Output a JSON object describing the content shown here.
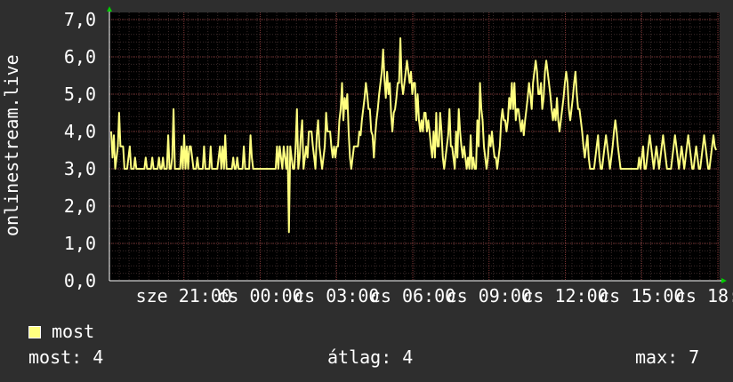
{
  "chart_data": {
    "type": "line",
    "y_axis_label": "onlinestream.live",
    "ylim": [
      0,
      7
    ],
    "y_ticks": [
      "0,0",
      "1,0",
      "2,0",
      "3,0",
      "4,0",
      "5,0",
      "6,0",
      "7,0"
    ],
    "x_ticks": [
      "sze 21:00",
      "cs 00:00",
      "cs 03:00",
      "cs 06:00",
      "cs 09:00",
      "cs 12:00",
      "cs 15:00",
      "cs 18:00"
    ],
    "grid": true,
    "series": [
      {
        "name": "most",
        "color": "#ffff80",
        "values": [
          4,
          3.3,
          3.9,
          3,
          3.3,
          3.6,
          4.5,
          3.6,
          3.6,
          3.6,
          3,
          3,
          3,
          3.3,
          3.6,
          3,
          3,
          3,
          3.3,
          3,
          3,
          3,
          3,
          3,
          3,
          3,
          3.3,
          3,
          3,
          3,
          3,
          3.3,
          3,
          3,
          3,
          3,
          3.3,
          3,
          3,
          3.3,
          3,
          3,
          3,
          3.9,
          3,
          3,
          3.3,
          4.6,
          3,
          3,
          3,
          3,
          3,
          3.6,
          3,
          3.9,
          3,
          3.6,
          3,
          3.6,
          3.6,
          3.3,
          3,
          3,
          3,
          3.3,
          3,
          3,
          3,
          3,
          3.6,
          3,
          3,
          3,
          3,
          3.6,
          3,
          3,
          3,
          3,
          3,
          3.3,
          3.6,
          3,
          3.6,
          3,
          3.9,
          3,
          3,
          3,
          3,
          3,
          3.3,
          3,
          3,
          3.3,
          3,
          3,
          3,
          3,
          3.6,
          3,
          3,
          3,
          3,
          3.9,
          3.3,
          3,
          3,
          3,
          3,
          3,
          3,
          3,
          3,
          3,
          3,
          3,
          3,
          3,
          3,
          3,
          3,
          3,
          3,
          3.6,
          3,
          3.6,
          3.3,
          3,
          3.6,
          3.3,
          3,
          3.6,
          1.3,
          3.6,
          3.3,
          3,
          3,
          3.6,
          4.6,
          3,
          3.3,
          3.9,
          4.3,
          3,
          3.3,
          3.6,
          3.3,
          4,
          4,
          4,
          3.6,
          3.3,
          3,
          3.9,
          4.3,
          3.6,
          3.3,
          3,
          3.3,
          3.6,
          4.5,
          4,
          4,
          4,
          3.6,
          3.3,
          3.6,
          3.3,
          3.6,
          3.6,
          4.3,
          4.6,
          5.3,
          4.3,
          4.9,
          4.6,
          5,
          4,
          3.3,
          3,
          3.3,
          3.6,
          3.6,
          3.6,
          3.6,
          4,
          3.9,
          4.3,
          4.6,
          4.9,
          5.3,
          5,
          4.6,
          4.6,
          4,
          3.9,
          3.3,
          3.9,
          4.3,
          4.6,
          5,
          5.3,
          5.6,
          6.2,
          5.4,
          4.9,
          5.6,
          5,
          5.3,
          4.5,
          4,
          4.5,
          4.6,
          4.9,
          5.3,
          5.3,
          6.5,
          5.3,
          5,
          5.3,
          5.6,
          5.9,
          5.6,
          5.3,
          5.6,
          5,
          5.3,
          5.3,
          4.3,
          5,
          4.3,
          4,
          4.3,
          4,
          4.5,
          4.5,
          4,
          4.3,
          4,
          3.6,
          3.3,
          4,
          3.3,
          4.5,
          3.6,
          3.6,
          4.5,
          4,
          3.3,
          3,
          3.3,
          3.6,
          3.9,
          4.6,
          3.6,
          3.6,
          3.3,
          3,
          4,
          3.3,
          4.6,
          4,
          3.6,
          3.3,
          3.6,
          3.3,
          3,
          3.3,
          3,
          3.9,
          3,
          3.3,
          3,
          3,
          4.3,
          3.6,
          5.3,
          4.6,
          4.3,
          3.6,
          3.3,
          3,
          3.3,
          3.9,
          3.6,
          4,
          3.6,
          3.3,
          3.3,
          3,
          3.3,
          3.6,
          4.3,
          4.6,
          4.3,
          4.3,
          4,
          4.3,
          4.9,
          4.6,
          5.3,
          4.6,
          5.3,
          4.3,
          4.6,
          4.6,
          4.3,
          4,
          4.3,
          3.9,
          4.3,
          4.6,
          4.9,
          5.3,
          5,
          4.6,
          5.3,
          5.6,
          5.9,
          5.6,
          5,
          5,
          5.3,
          4.6,
          4.9,
          5.6,
          5.9,
          5.6,
          5.3,
          5,
          4.6,
          4.3,
          4.6,
          4.3,
          4.9,
          4.3,
          4,
          4.3,
          4.6,
          4.9,
          5.3,
          5.6,
          5.3,
          4.6,
          4.3,
          4.6,
          4.9,
          5.3,
          5.6,
          5,
          4.6,
          4.6,
          4.3,
          4,
          3.6,
          3.3,
          3.6,
          3.9,
          3.3,
          3,
          3,
          3,
          3,
          3.3,
          3.6,
          3.9,
          3.3,
          3,
          3,
          3.3,
          3.6,
          3.9,
          3.6,
          3.3,
          3,
          3.3,
          3.6,
          4,
          4.3,
          4,
          3.6,
          3.3,
          3,
          3,
          3,
          3,
          3,
          3,
          3,
          3,
          3,
          3,
          3,
          3,
          3,
          3,
          3.3,
          3,
          3.3,
          3.6,
          3,
          3,
          3.3,
          3.6,
          3.9,
          3.6,
          3.3,
          3,
          3.3,
          3.6,
          3.3,
          3,
          3.3,
          3.6,
          3.9,
          3.6,
          3.3,
          3,
          3,
          3,
          3,
          3.3,
          3.6,
          3.9,
          3.6,
          3.3,
          3,
          3.3,
          3.6,
          3.3,
          3,
          3.3,
          3.6,
          3.9,
          3.6,
          3.3,
          3,
          3,
          3.3,
          3.6,
          3.3,
          3,
          3,
          3.3,
          3.6,
          3.9,
          3.6,
          3.3,
          3,
          3,
          3.3,
          3.6,
          3.9,
          3.6,
          3.5
        ]
      }
    ]
  },
  "legend": {
    "label": "most",
    "color": "#ffff80"
  },
  "stats": {
    "now_label": "most:",
    "now_value": "4",
    "avg_label": "átlag:",
    "avg_value": "4",
    "max_label": "max:",
    "max_value": "7"
  }
}
